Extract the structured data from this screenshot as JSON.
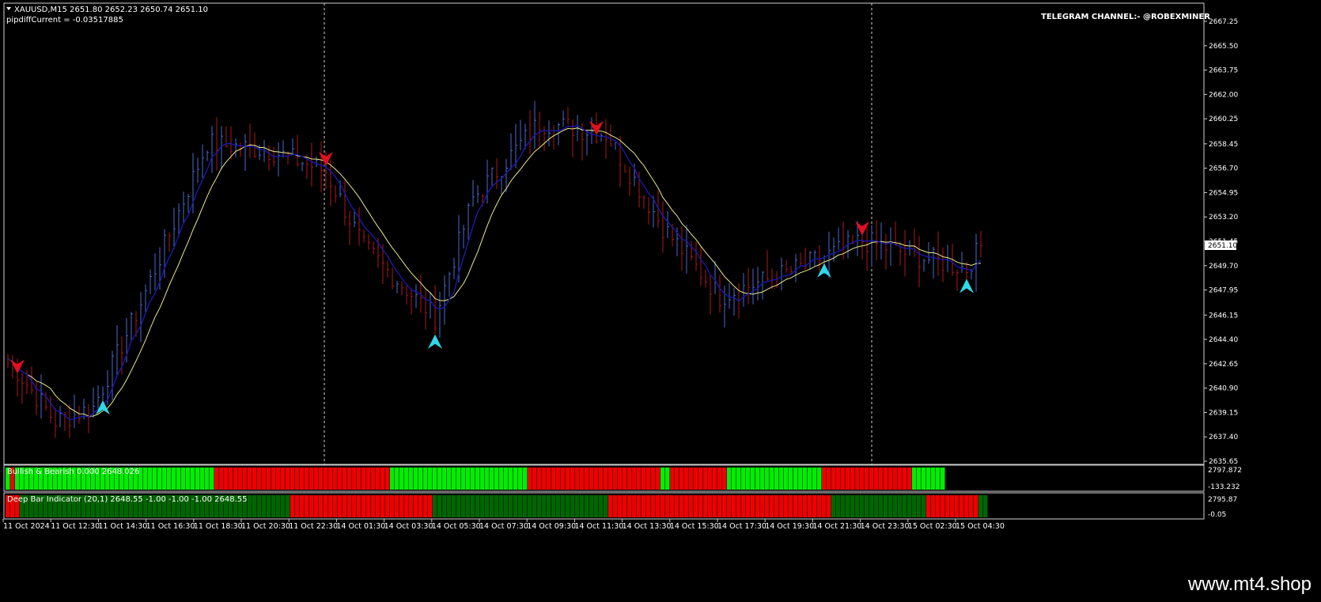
{
  "header": {
    "symbol_line": "XAUUSD,M15  2651.80 2652.23 2650.74 2651.10",
    "indicator_line": "pipdiffCurrent = -0.03517885",
    "telegram": "TELEGRAM CHANNEL:- @ROBEXMINER"
  },
  "price_axis": {
    "ticks": [
      "2667.25",
      "2665.50",
      "2663.75",
      "2662.00",
      "2660.25",
      "2658.45",
      "2656.70",
      "2654.95",
      "2653.20",
      "2651.45",
      "2649.70",
      "2647.95",
      "2646.15",
      "2644.40",
      "2642.65",
      "2640.90",
      "2639.15",
      "2637.40",
      "2635.65"
    ],
    "current_price": "2651.10",
    "min": 2635.65,
    "max": 2667.25
  },
  "subpanel1": {
    "label": "Bullish & Bearish 0.000 2648.026",
    "axis_top": "2797.872",
    "axis_bottom": "-133.232",
    "blocks": [
      {
        "color": "#00ee00",
        "n": 1
      },
      {
        "color": "#ee0000",
        "n": 1
      },
      {
        "color": "#00ee00",
        "n": 42
      },
      {
        "color": "#ee0000",
        "n": 37
      },
      {
        "color": "#00ee00",
        "n": 29
      },
      {
        "color": "#ee0000",
        "n": 28
      },
      {
        "color": "#00ee00",
        "n": 2
      },
      {
        "color": "#ee0000",
        "n": 12
      },
      {
        "color": "#00ee00",
        "n": 20
      },
      {
        "color": "#ee0000",
        "n": 19
      },
      {
        "color": "#00ee00",
        "n": 7
      }
    ]
  },
  "subpanel2": {
    "label": "Deep Bar Indicator (20,1) 2648.55 -1.00 -1.00 -1.00 2648.55",
    "axis_top": "2795.87",
    "axis_bottom": "-0.05",
    "blocks": [
      {
        "color": "#ee0000",
        "n": 3
      },
      {
        "color": "#006600",
        "n": 57
      },
      {
        "color": "#ee0000",
        "n": 30
      },
      {
        "color": "#006600",
        "n": 37
      },
      {
        "color": "#ee0000",
        "n": 47
      },
      {
        "color": "#006600",
        "n": 20
      },
      {
        "color": "#ee0000",
        "n": 11
      },
      {
        "color": "#006600",
        "n": 2
      }
    ]
  },
  "time_axis": [
    "11 Oct 2024",
    "11 Oct 12:30",
    "11 Oct 14:30",
    "11 Oct 16:30",
    "11 Oct 18:30",
    "11 Oct 20:30",
    "11 Oct 22:30",
    "14 Oct 01:30",
    "14 Oct 03:30",
    "14 Oct 05:30",
    "14 Oct 07:30",
    "14 Oct 09:30",
    "14 Oct 11:30",
    "14 Oct 13:30",
    "14 Oct 15:30",
    "14 Oct 17:30",
    "14 Oct 19:30",
    "14 Oct 21:30",
    "14 Oct 23:30",
    "15 Oct 02:30",
    "15 Oct 04:30"
  ],
  "watermark": "www.mt4.shop",
  "chart_data": {
    "type": "candlestick",
    "timeframe": "M15",
    "symbol": "XAUUSD",
    "key_points": [
      {
        "bar": 0,
        "price": 2643.0
      },
      {
        "bar": 10,
        "price": 2638.5
      },
      {
        "bar": 18,
        "price": 2639.5
      },
      {
        "bar": 28,
        "price": 2647.0
      },
      {
        "bar": 42,
        "price": 2658.5
      },
      {
        "bar": 55,
        "price": 2658.0
      },
      {
        "bar": 67,
        "price": 2656.5
      },
      {
        "bar": 75,
        "price": 2651.0
      },
      {
        "bar": 90,
        "price": 2646.0
      },
      {
        "bar": 98,
        "price": 2654.5
      },
      {
        "bar": 112,
        "price": 2660.0
      },
      {
        "bar": 126,
        "price": 2659.2
      },
      {
        "bar": 138,
        "price": 2652.5
      },
      {
        "bar": 150,
        "price": 2647.5
      },
      {
        "bar": 165,
        "price": 2649.3
      },
      {
        "bar": 180,
        "price": 2651.5
      },
      {
        "bar": 190,
        "price": 2650.5
      },
      {
        "bar": 202,
        "price": 2649.5
      },
      {
        "bar": 205,
        "price": 2651.1
      }
    ],
    "ma_fast_color": "#1a1aaa",
    "ma_slow_color": "#e8e88a",
    "signals": [
      {
        "bar": 2,
        "type": "sell"
      },
      {
        "bar": 20,
        "type": "buy"
      },
      {
        "bar": 67,
        "type": "sell"
      },
      {
        "bar": 90,
        "type": "buy"
      },
      {
        "bar": 124,
        "type": "sell"
      },
      {
        "bar": 172,
        "type": "buy"
      },
      {
        "bar": 180,
        "type": "sell"
      },
      {
        "bar": 202,
        "type": "buy"
      }
    ],
    "bull_color": "#4a6ad0",
    "bear_color": "#b01818"
  }
}
